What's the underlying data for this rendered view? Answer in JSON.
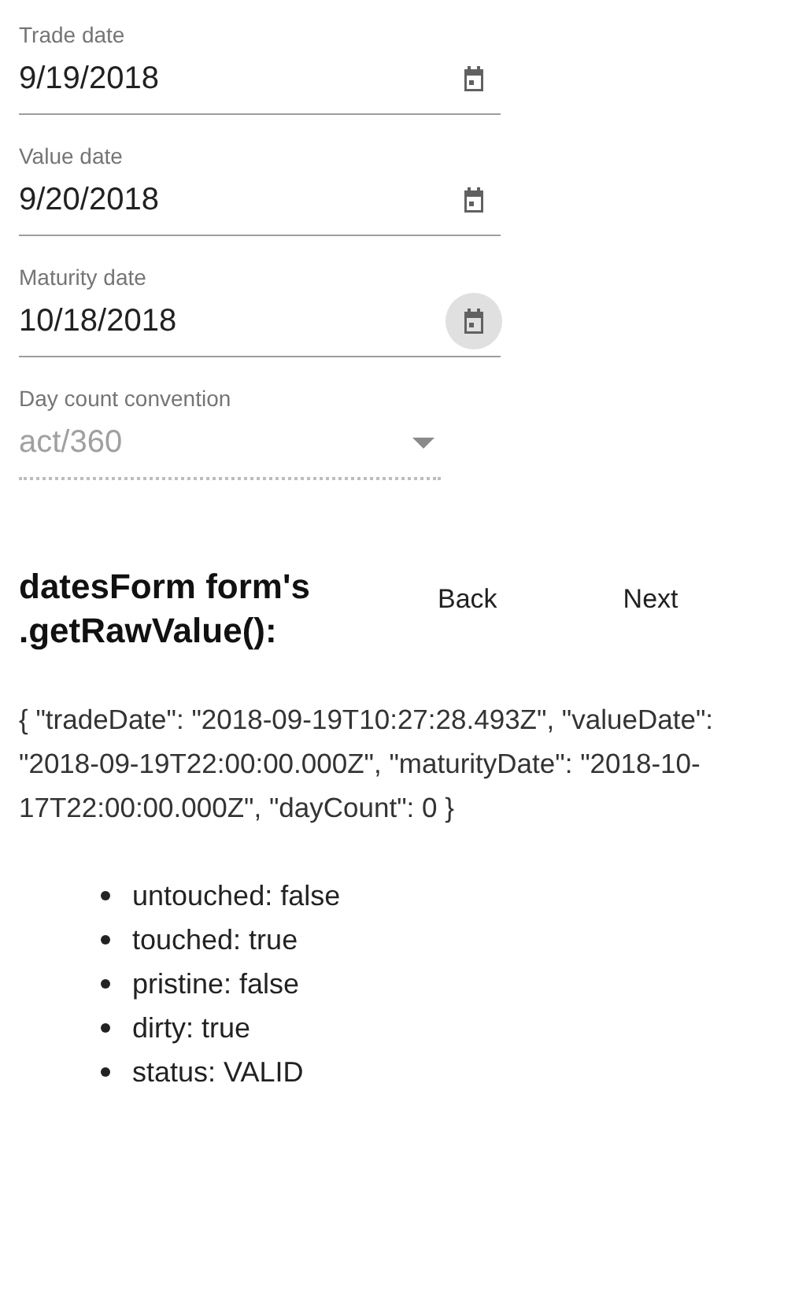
{
  "fields": [
    {
      "kind": "date",
      "label": "Trade date",
      "value": "9/19/2018",
      "focused": false
    },
    {
      "kind": "date",
      "label": "Value date",
      "value": "9/20/2018",
      "focused": false
    },
    {
      "kind": "date",
      "label": "Maturity date",
      "value": "10/18/2018",
      "focused": true
    },
    {
      "kind": "select",
      "label": "Day count convention",
      "value": "act/360",
      "disabled": true
    }
  ],
  "heading": "datesForm form's .getRawValue():",
  "buttons": [
    "Back",
    "Next"
  ],
  "raw_value": "{ \"tradeDate\": \"2018-09-19T10:27:28.493Z\", \"valueDate\": \"2018-09-19T22:00:00.000Z\", \"maturityDate\": \"2018-10-17T22:00:00.000Z\", \"dayCount\": 0 }",
  "status_items": [
    "untouched: false",
    "touched: true",
    "pristine: false",
    "dirty: true",
    "status: VALID"
  ]
}
